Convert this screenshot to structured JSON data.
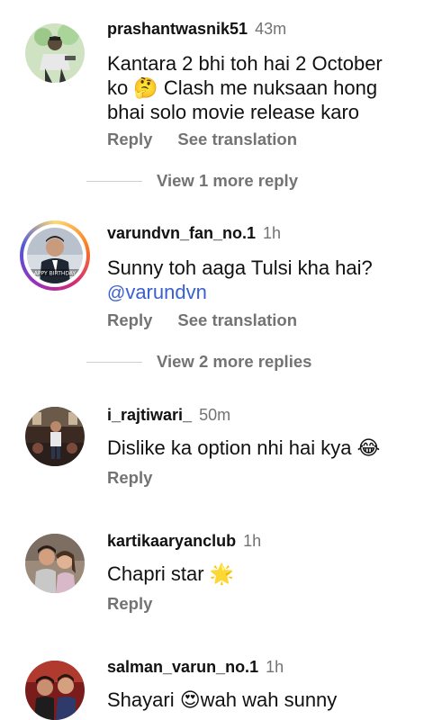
{
  "comments": [
    {
      "username": "prashantwasnik51",
      "time": "43m",
      "text_lines": [
        "Kantara 2 bhi toh hai 2 October",
        "ko 🤔 Clash me nuksaan hong",
        "bhai solo movie release karo"
      ],
      "reply_label": "Reply",
      "translate_label": "See translation"
    },
    {
      "username": "varundvn_fan_no.1",
      "time": "1h",
      "text_lines": [
        "Sunny toh aaga Tulsi kha hai?"
      ],
      "mention_icon": "@",
      "mention": "varundvn",
      "avatar_caption": "APPY BIRTHDAY",
      "reply_label": "Reply",
      "translate_label": "See translation"
    },
    {
      "username": "i_rajtiwari_",
      "time": "50m",
      "text_lines": [
        "Dislike ka option nhi hai kya 😂"
      ],
      "reply_label": "Reply"
    },
    {
      "username": "kartikaaryanclub",
      "time": "1h",
      "text_lines": [
        "Chapri star 🌟"
      ],
      "reply_label": "Reply"
    },
    {
      "username": "salman_varun_no.1",
      "time": "1h",
      "text_lines": [
        "Shayari 😍wah wah sunny"
      ]
    }
  ],
  "view_more": [
    {
      "label": "View 1 more reply"
    },
    {
      "label": "View 2 more replies"
    }
  ],
  "colors": {
    "text": "#111111",
    "secondary": "#737373",
    "mention": "#3a5fd0",
    "divider": "#cfcfcf"
  }
}
